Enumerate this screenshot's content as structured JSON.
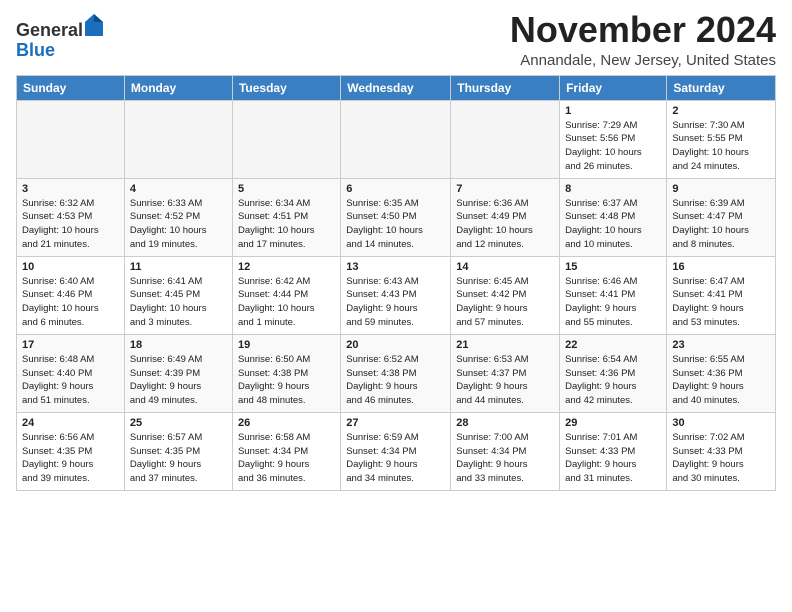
{
  "header": {
    "logo_general": "General",
    "logo_blue": "Blue",
    "month": "November 2024",
    "location": "Annandale, New Jersey, United States"
  },
  "weekdays": [
    "Sunday",
    "Monday",
    "Tuesday",
    "Wednesday",
    "Thursday",
    "Friday",
    "Saturday"
  ],
  "weeks": [
    [
      {
        "day": "",
        "info": ""
      },
      {
        "day": "",
        "info": ""
      },
      {
        "day": "",
        "info": ""
      },
      {
        "day": "",
        "info": ""
      },
      {
        "day": "",
        "info": ""
      },
      {
        "day": "1",
        "info": "Sunrise: 7:29 AM\nSunset: 5:56 PM\nDaylight: 10 hours\nand 26 minutes."
      },
      {
        "day": "2",
        "info": "Sunrise: 7:30 AM\nSunset: 5:55 PM\nDaylight: 10 hours\nand 24 minutes."
      }
    ],
    [
      {
        "day": "3",
        "info": "Sunrise: 6:32 AM\nSunset: 4:53 PM\nDaylight: 10 hours\nand 21 minutes."
      },
      {
        "day": "4",
        "info": "Sunrise: 6:33 AM\nSunset: 4:52 PM\nDaylight: 10 hours\nand 19 minutes."
      },
      {
        "day": "5",
        "info": "Sunrise: 6:34 AM\nSunset: 4:51 PM\nDaylight: 10 hours\nand 17 minutes."
      },
      {
        "day": "6",
        "info": "Sunrise: 6:35 AM\nSunset: 4:50 PM\nDaylight: 10 hours\nand 14 minutes."
      },
      {
        "day": "7",
        "info": "Sunrise: 6:36 AM\nSunset: 4:49 PM\nDaylight: 10 hours\nand 12 minutes."
      },
      {
        "day": "8",
        "info": "Sunrise: 6:37 AM\nSunset: 4:48 PM\nDaylight: 10 hours\nand 10 minutes."
      },
      {
        "day": "9",
        "info": "Sunrise: 6:39 AM\nSunset: 4:47 PM\nDaylight: 10 hours\nand 8 minutes."
      }
    ],
    [
      {
        "day": "10",
        "info": "Sunrise: 6:40 AM\nSunset: 4:46 PM\nDaylight: 10 hours\nand 6 minutes."
      },
      {
        "day": "11",
        "info": "Sunrise: 6:41 AM\nSunset: 4:45 PM\nDaylight: 10 hours\nand 3 minutes."
      },
      {
        "day": "12",
        "info": "Sunrise: 6:42 AM\nSunset: 4:44 PM\nDaylight: 10 hours\nand 1 minute."
      },
      {
        "day": "13",
        "info": "Sunrise: 6:43 AM\nSunset: 4:43 PM\nDaylight: 9 hours\nand 59 minutes."
      },
      {
        "day": "14",
        "info": "Sunrise: 6:45 AM\nSunset: 4:42 PM\nDaylight: 9 hours\nand 57 minutes."
      },
      {
        "day": "15",
        "info": "Sunrise: 6:46 AM\nSunset: 4:41 PM\nDaylight: 9 hours\nand 55 minutes."
      },
      {
        "day": "16",
        "info": "Sunrise: 6:47 AM\nSunset: 4:41 PM\nDaylight: 9 hours\nand 53 minutes."
      }
    ],
    [
      {
        "day": "17",
        "info": "Sunrise: 6:48 AM\nSunset: 4:40 PM\nDaylight: 9 hours\nand 51 minutes."
      },
      {
        "day": "18",
        "info": "Sunrise: 6:49 AM\nSunset: 4:39 PM\nDaylight: 9 hours\nand 49 minutes."
      },
      {
        "day": "19",
        "info": "Sunrise: 6:50 AM\nSunset: 4:38 PM\nDaylight: 9 hours\nand 48 minutes."
      },
      {
        "day": "20",
        "info": "Sunrise: 6:52 AM\nSunset: 4:38 PM\nDaylight: 9 hours\nand 46 minutes."
      },
      {
        "day": "21",
        "info": "Sunrise: 6:53 AM\nSunset: 4:37 PM\nDaylight: 9 hours\nand 44 minutes."
      },
      {
        "day": "22",
        "info": "Sunrise: 6:54 AM\nSunset: 4:36 PM\nDaylight: 9 hours\nand 42 minutes."
      },
      {
        "day": "23",
        "info": "Sunrise: 6:55 AM\nSunset: 4:36 PM\nDaylight: 9 hours\nand 40 minutes."
      }
    ],
    [
      {
        "day": "24",
        "info": "Sunrise: 6:56 AM\nSunset: 4:35 PM\nDaylight: 9 hours\nand 39 minutes."
      },
      {
        "day": "25",
        "info": "Sunrise: 6:57 AM\nSunset: 4:35 PM\nDaylight: 9 hours\nand 37 minutes."
      },
      {
        "day": "26",
        "info": "Sunrise: 6:58 AM\nSunset: 4:34 PM\nDaylight: 9 hours\nand 36 minutes."
      },
      {
        "day": "27",
        "info": "Sunrise: 6:59 AM\nSunset: 4:34 PM\nDaylight: 9 hours\nand 34 minutes."
      },
      {
        "day": "28",
        "info": "Sunrise: 7:00 AM\nSunset: 4:34 PM\nDaylight: 9 hours\nand 33 minutes."
      },
      {
        "day": "29",
        "info": "Sunrise: 7:01 AM\nSunset: 4:33 PM\nDaylight: 9 hours\nand 31 minutes."
      },
      {
        "day": "30",
        "info": "Sunrise: 7:02 AM\nSunset: 4:33 PM\nDaylight: 9 hours\nand 30 minutes."
      }
    ]
  ]
}
